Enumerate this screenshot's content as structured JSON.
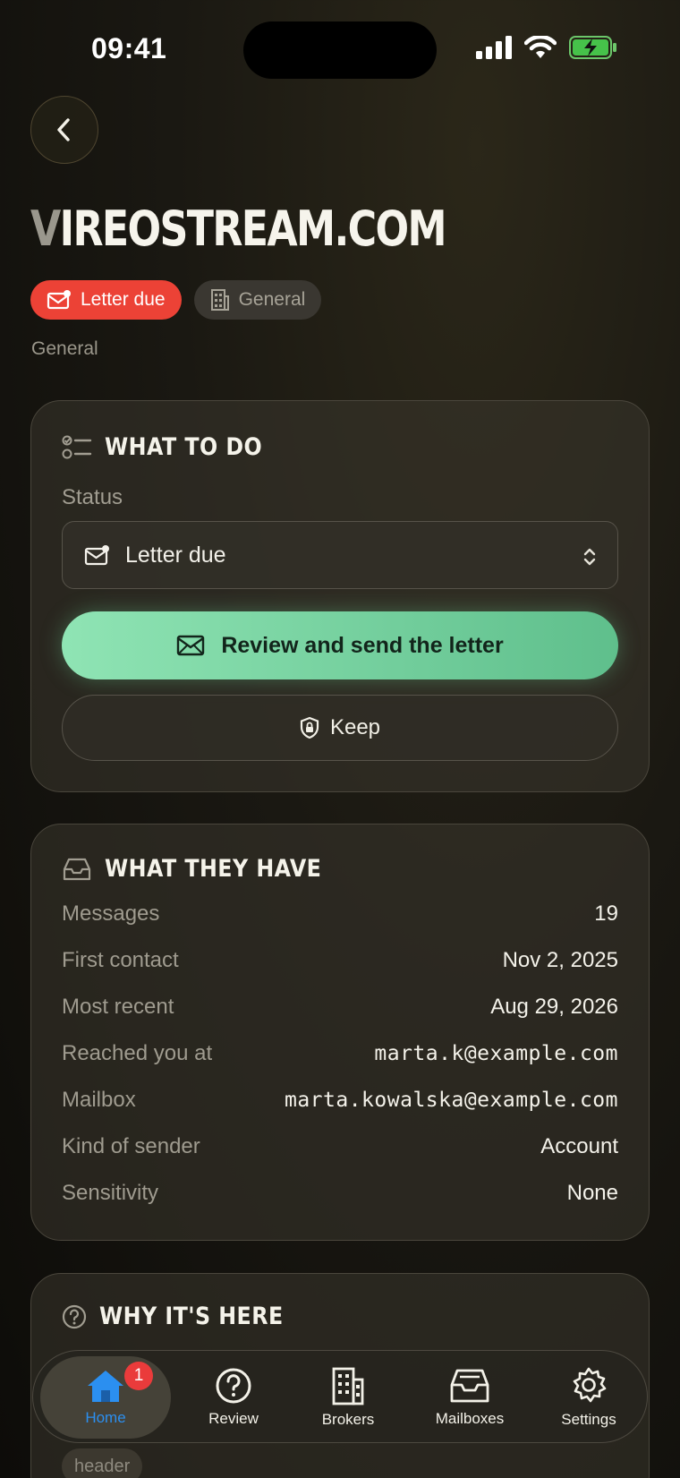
{
  "status_bar": {
    "time": "09:41"
  },
  "header": {
    "title_first": "V",
    "title_rest": "IREOSTREAM.COM",
    "chips": [
      {
        "label": "Letter due",
        "color": "#ec4236"
      },
      {
        "label": "General"
      }
    ],
    "subtitle": "General"
  },
  "todo": {
    "title": "WHAT TO DO",
    "status_label": "Status",
    "status_value": "Letter due",
    "primary_button": "Review and send the letter",
    "secondary_button": "Keep"
  },
  "have": {
    "title": "WHAT THEY HAVE",
    "rows": [
      {
        "key": "Messages",
        "value": "19"
      },
      {
        "key": "First contact",
        "value": "Nov 2, 2025"
      },
      {
        "key": "Most recent",
        "value": "Aug 29, 2026"
      },
      {
        "key": "Reached you at",
        "value": "marta.k@example.com"
      },
      {
        "key": "Mailbox",
        "value": "marta.kowalska@example.com"
      },
      {
        "key": "Kind of sender",
        "value": "Account"
      },
      {
        "key": "Sensitivity",
        "value": "None"
      }
    ]
  },
  "why": {
    "title": "WHY IT'S HERE",
    "partial_text": "header"
  },
  "tabbar": {
    "tabs": [
      {
        "label": "Home",
        "icon": "home-icon",
        "active": true,
        "badge": "1"
      },
      {
        "label": "Review",
        "icon": "question-icon"
      },
      {
        "label": "Brokers",
        "icon": "building-icon"
      },
      {
        "label": "Mailboxes",
        "icon": "inbox-icon"
      },
      {
        "label": "Settings",
        "icon": "gear-icon"
      }
    ],
    "active_color": "#2b8ff0"
  }
}
